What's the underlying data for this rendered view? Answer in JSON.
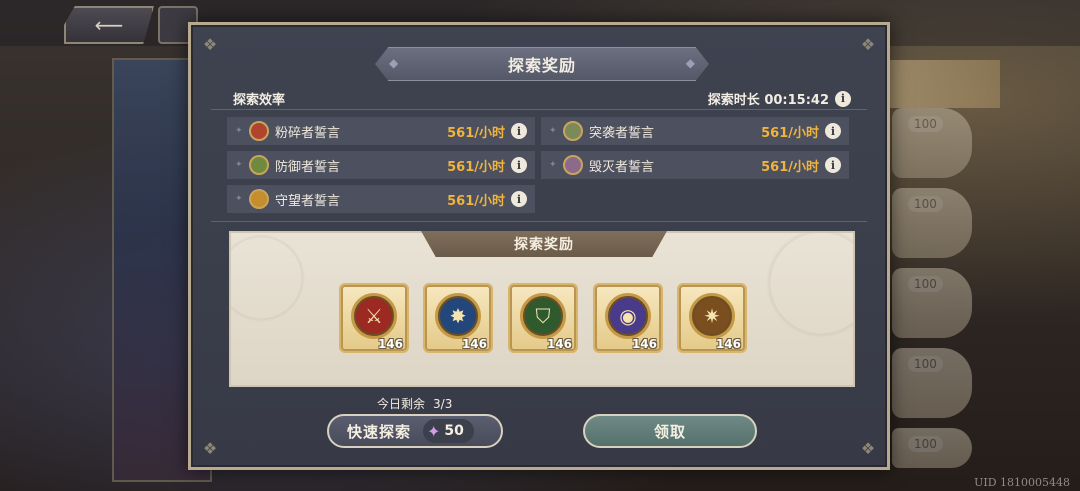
{
  "background": {
    "card_costs": [
      "100",
      "100",
      "100",
      "100",
      "100"
    ],
    "uid": "UID 1810005448"
  },
  "dialog": {
    "title": "探索奖励",
    "efficiency_label": "探索效率",
    "duration_label": "探索时长 00:15:42",
    "info_glyph": "i",
    "rates": [
      {
        "name": "粉碎者誓言",
        "value": "561/小时",
        "medal_color": "#b0442e"
      },
      {
        "name": "突袭者誓言",
        "value": "561/小时",
        "medal_color": "#7c8a5a"
      },
      {
        "name": "防御者誓言",
        "value": "561/小时",
        "medal_color": "#6f8a3e"
      },
      {
        "name": "毁灭者誓言",
        "value": "561/小时",
        "medal_color": "#8c6a8a"
      },
      {
        "name": "守望者誓言",
        "value": "561/小时",
        "medal_color": "#c48e2c"
      }
    ],
    "reward_tab": "探索奖励",
    "rewards": [
      {
        "qty": "146",
        "color": "#9c2a22",
        "icon": "crossed-swords-icon"
      },
      {
        "qty": "146",
        "color": "#23477a",
        "icon": "star-burst-icon"
      },
      {
        "qty": "146",
        "color": "#2f5a2e",
        "icon": "shield-icon"
      },
      {
        "qty": "146",
        "color": "#4a3a8a",
        "icon": "eye-icon"
      },
      {
        "qty": "146",
        "color": "#7a4e1e",
        "icon": "compass-star-icon"
      }
    ],
    "remaining_label": "今日剩余",
    "remaining_value": "3/3",
    "quick_label": "快速探索",
    "quick_cost": "50",
    "claim_label": "领取"
  },
  "colors": {
    "rate_value": "#f0b43c",
    "panel": "#e9e3d6",
    "claim_button": "#5f7b77"
  }
}
